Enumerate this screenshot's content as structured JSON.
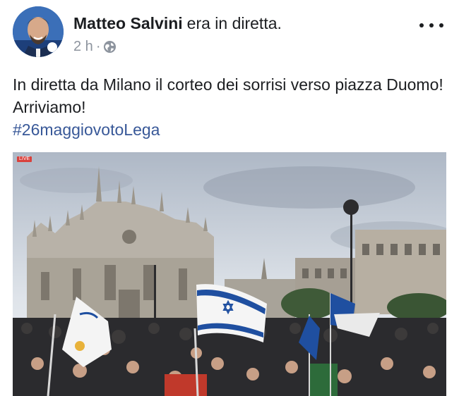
{
  "post": {
    "author": {
      "name": "Matteo Salvini",
      "action": "era in diretta."
    },
    "meta": {
      "time": "2 h",
      "separator": "·",
      "privacy_icon": "globe-icon"
    },
    "more_icon": "ellipsis-icon",
    "text": {
      "body": "In diretta da Milano il corteo dei sorrisi verso piazza Duomo! Arriviamo!",
      "hashtag": "#26maggiovotoLega"
    },
    "media": {
      "type": "live-video-still",
      "live_badge": "LIVE",
      "colors": {
        "sky": "#cfd6df",
        "cathedral": "#b9b4ab",
        "crowd": "#2b2b2e",
        "flag_blue": "#1f4fa0"
      }
    }
  }
}
